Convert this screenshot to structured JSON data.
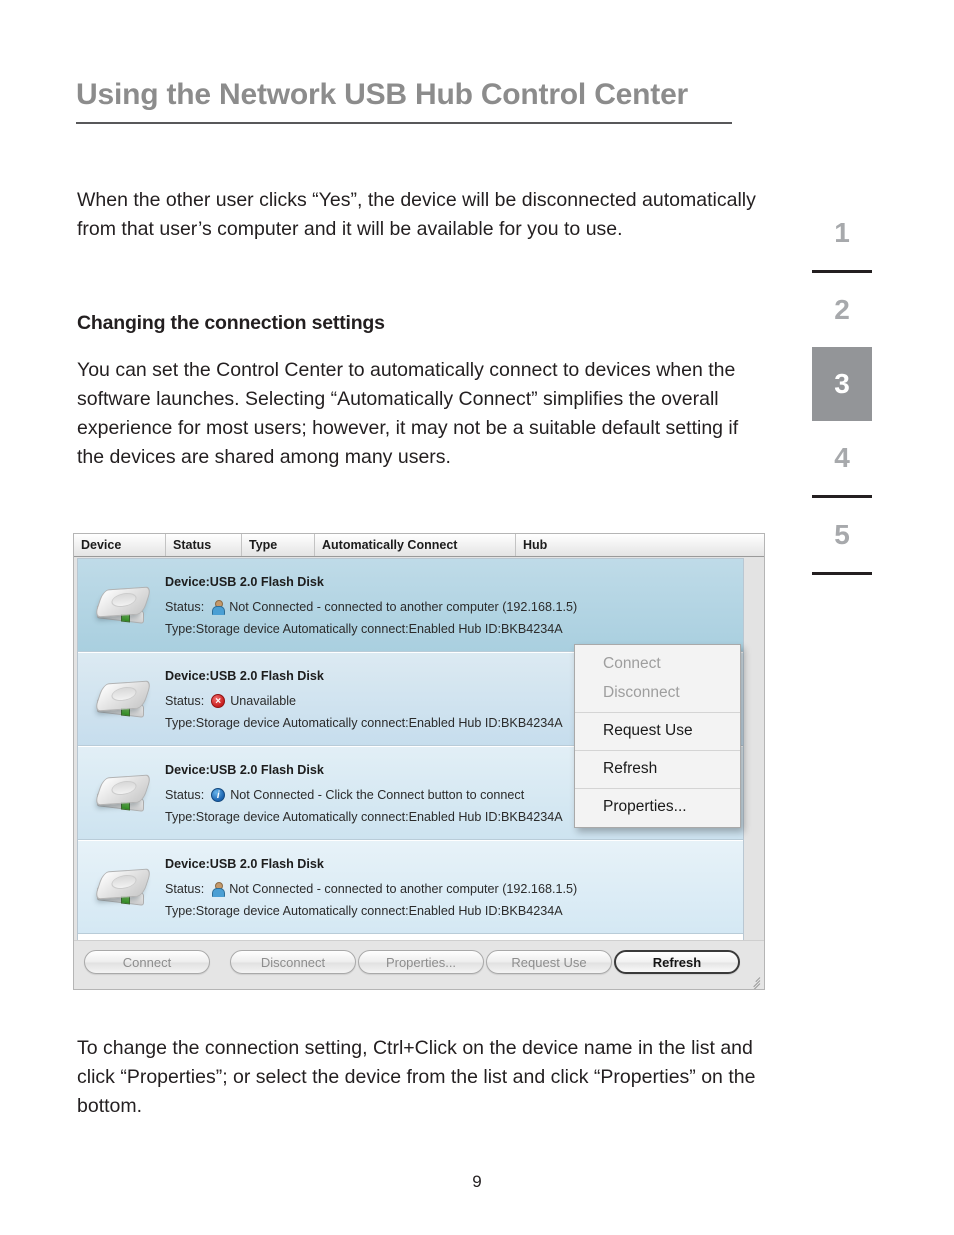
{
  "page": {
    "title": "Using the Network USB Hub Control Center",
    "number": "9"
  },
  "paragraphs": {
    "intro": "When the other user clicks “Yes”, the device will be disconnected automatically from that user’s computer and it will be available for you to use.",
    "subhead": "Changing the connection settings",
    "body": "You can set the Control Center to automatically connect to devices when the software launches. Selecting “Automatically Connect” simplifies the overall experience for most users; however, it may not be a suitable default setting if the devices are shared among many users.",
    "footer": "To change the connection setting, Ctrl+Click on the device name in the list and click “Properties”; or select the device from the list and click “Properties” on the bottom."
  },
  "chapter_tabs": {
    "items": [
      {
        "label": "1",
        "active": false
      },
      {
        "label": "2",
        "active": false
      },
      {
        "label": "3",
        "active": true
      },
      {
        "label": "4",
        "active": false
      },
      {
        "label": "5",
        "active": false
      }
    ],
    "active_color": "#939598",
    "inactive_color": "#a7a9ac"
  },
  "app": {
    "columns": [
      "Device",
      "Status",
      "Type",
      "Automatically Connect",
      "Hub"
    ],
    "devices": [
      {
        "name": "Device:USB 2.0 Flash Disk",
        "status_label": "Status:",
        "status_icon": "person-icon",
        "status_text": "Not Connected - connected to another computer (192.168.1.5)",
        "meta": "Type:Storage device   Automatically connect:Enabled   Hub ID:BKB4234A",
        "selected": true
      },
      {
        "name": "Device:USB 2.0 Flash Disk",
        "status_label": "Status:",
        "status_icon": "error-icon",
        "status_text": "Unavailable",
        "meta": "Type:Storage device   Automatically connect:Enabled   Hub ID:BKB4234A",
        "selected": false
      },
      {
        "name": "Device:USB 2.0 Flash Disk",
        "status_label": "Status:",
        "status_icon": "info-icon",
        "status_text": "Not Connected - Click the Connect button to connect",
        "meta": "Type:Storage device   Automatically connect:Enabled   Hub ID:BKB4234A",
        "selected": false
      },
      {
        "name": "Device:USB 2.0 Flash Disk",
        "status_label": "Status:",
        "status_icon": "person-icon",
        "status_text": "Not Connected - connected to another computer (192.168.1.5)",
        "meta": "Type:Storage device   Automatically connect:Enabled   Hub ID:BKB4234A",
        "selected": false
      }
    ],
    "context_menu": [
      {
        "label": "Connect",
        "disabled": true
      },
      {
        "label": "Disconnect",
        "disabled": true
      },
      {
        "label": "Request Use",
        "disabled": false
      },
      {
        "label": "Refresh",
        "disabled": false
      },
      {
        "label": "Properties...",
        "disabled": false
      }
    ],
    "buttons": {
      "connect": "Connect",
      "disconnect": "Disconnect",
      "properties": "Properties...",
      "request_use": "Request Use",
      "refresh": "Refresh"
    }
  }
}
